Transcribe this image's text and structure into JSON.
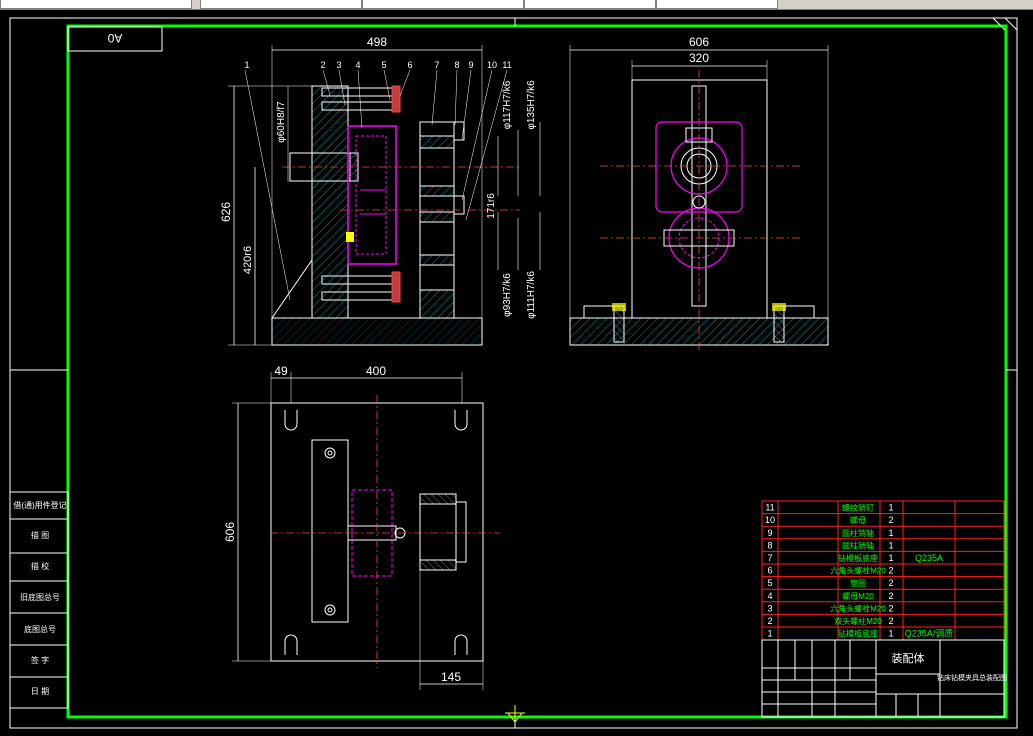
{
  "title_box": "A0",
  "dimensions": {
    "d498": "498",
    "d606_top": "606",
    "d320": "320",
    "d626": "626",
    "d420": "420r6",
    "d171": "171r6",
    "d60": "φ60H8/f7",
    "d117": "φ117H7/k6",
    "d135": "φ135H7/k6",
    "d93": "φ93H7/k6",
    "d111": "φ111H7/k6",
    "d49": "49",
    "d400": "400",
    "d606_left": "606",
    "d145": "145"
  },
  "balloons": [
    "1",
    "2",
    "3",
    "4",
    "5",
    "6",
    "7",
    "8",
    "9",
    "10",
    "11"
  ],
  "left_stamp": [
    "借(通)用件登记",
    "描 图",
    "描 校",
    "旧底图总号",
    "底图总号",
    "签 字",
    "日 期"
  ],
  "bom": [
    {
      "no": "11",
      "name": "螺纹销钉",
      "qty": "1",
      "material": ""
    },
    {
      "no": "10",
      "name": "螺母",
      "qty": "2",
      "material": ""
    },
    {
      "no": "9",
      "name": "圆柱销轴",
      "qty": "1",
      "material": ""
    },
    {
      "no": "8",
      "name": "圆柱销轴",
      "qty": "1",
      "material": ""
    },
    {
      "no": "7",
      "name": "钻模板底座",
      "qty": "1",
      "material": "Q235A"
    },
    {
      "no": "6",
      "name": "六角头螺栓M20",
      "qty": "2",
      "material": ""
    },
    {
      "no": "5",
      "name": "垫圈",
      "qty": "2",
      "material": ""
    },
    {
      "no": "4",
      "name": "螺母M20",
      "qty": "2",
      "material": ""
    },
    {
      "no": "3",
      "name": "六角头螺栓M20",
      "qty": "2",
      "material": ""
    },
    {
      "no": "2",
      "name": "双头螺柱M20",
      "qty": "2",
      "material": ""
    },
    {
      "no": "1",
      "name": "钻模板底座",
      "qty": "1",
      "material": "Q235A/调质"
    }
  ],
  "title_block": {
    "name": "装配体",
    "drawing": "钻床钻模夹具总装配图"
  },
  "colors": {
    "frame": "#00ff00",
    "lines": "#ffffff",
    "hatch": "#00c0c0",
    "part": "#ff00ff",
    "table": "#ff0000",
    "text_green": "#00ff00",
    "text_yellow": "#ffff00"
  }
}
